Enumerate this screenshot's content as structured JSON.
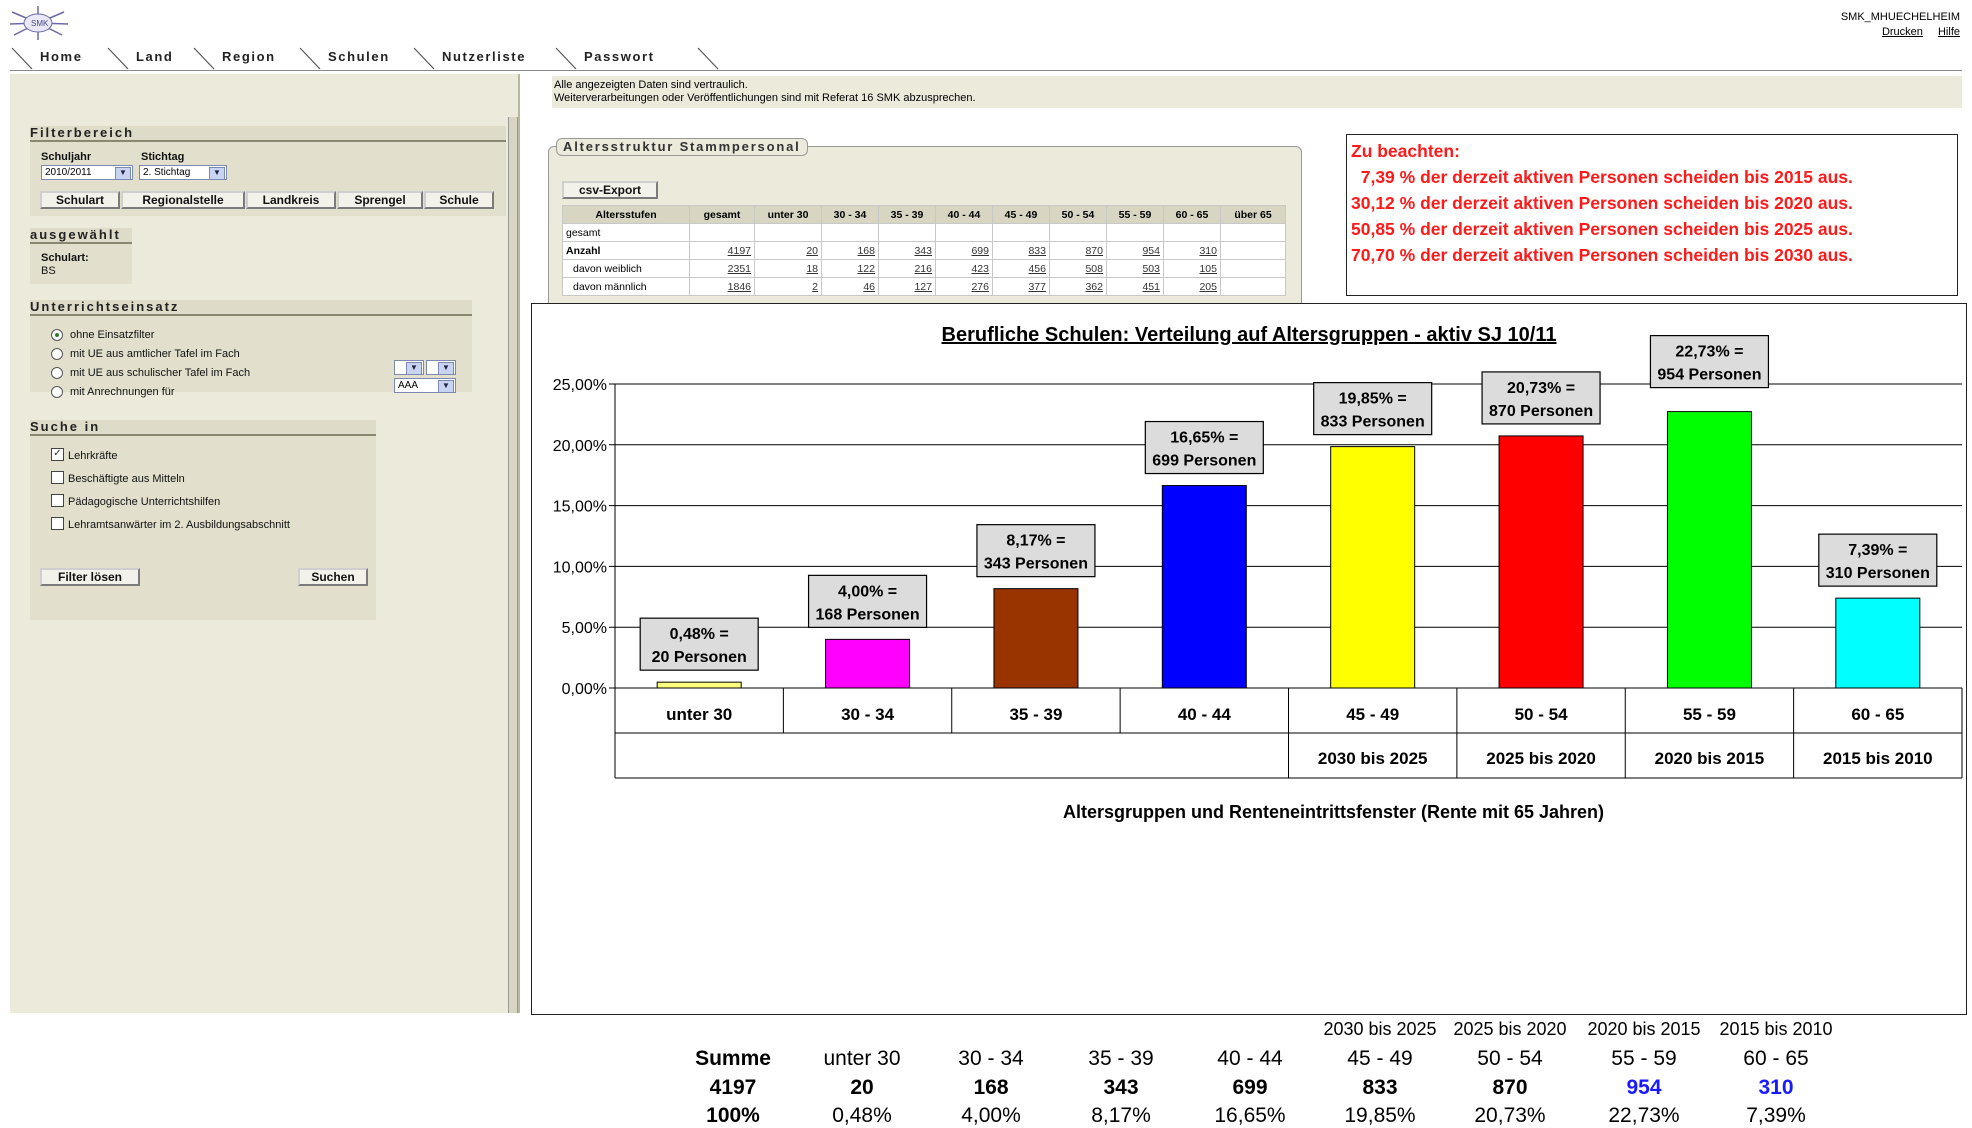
{
  "header": {
    "user": "SMK_MHUECHELHEIM",
    "print_link": "Drucken",
    "help_link": "Hilfe",
    "logo_icon": "sunburst-logo-icon"
  },
  "nav": {
    "tabs": [
      "Home",
      "Land",
      "Region",
      "Schulen",
      "Nutzerliste",
      "Passwort"
    ]
  },
  "notice": {
    "line1": "Alle angezeigten Daten sind vertraulich.",
    "line2": "Weiterverarbeitungen oder Veröffentlichungen sind mit Referat 16 SMK abzusprechen."
  },
  "filter": {
    "title": "Filterbereich",
    "schuljahr_label": "Schuljahr",
    "schuljahr_value": "2010/2011",
    "stichtag_label": "Stichtag",
    "stichtag_value": "2. Stichtag",
    "buttons": [
      "Schulart",
      "Regionalstelle",
      "Landkreis",
      "Sprengel",
      "Schule"
    ]
  },
  "selected": {
    "title": "ausgewählt",
    "label": "Schulart:",
    "value": "BS"
  },
  "unterricht": {
    "title": "Unterrichtseinsatz",
    "options": [
      "ohne Einsatzfilter",
      "mit UE aus amtlicher Tafel im Fach",
      "mit UE aus schulischer Tafel im Fach",
      "mit Anrechnungen für"
    ],
    "selected_index": 0,
    "anrechnung_value": "AAA"
  },
  "suche": {
    "title": "Suche in",
    "options": [
      "Lehrkräfte",
      "Beschäftigte aus Mitteln",
      "Pädagogische Unterrichtshilfen",
      "Lehramtsanwärter im 2. Ausbildungsabschnitt"
    ],
    "checked": [
      true,
      false,
      false,
      false
    ],
    "reset_button": "Filter lösen",
    "search_button": "Suchen"
  },
  "altersstruktur": {
    "legend": "Altersstruktur Stammpersonal",
    "csv_button": "csv-Export",
    "headers": [
      "Altersstufen",
      "gesamt",
      "unter 30",
      "30 - 34",
      "35 - 39",
      "40 - 44",
      "45 - 49",
      "50 - 54",
      "55 - 59",
      "60 - 65",
      "über 65"
    ],
    "rows": [
      {
        "label": "gesamt",
        "values": [
          "",
          "",
          "",
          "",
          "",
          "",
          "",
          "",
          "",
          ""
        ]
      },
      {
        "label": "Anzahl",
        "values": [
          "4197",
          "20",
          "168",
          "343",
          "699",
          "833",
          "870",
          "954",
          "310",
          ""
        ]
      },
      {
        "label": "davon weiblich",
        "values": [
          "2351",
          "18",
          "122",
          "216",
          "423",
          "456",
          "508",
          "503",
          "105",
          ""
        ]
      },
      {
        "label": "davon männlich",
        "values": [
          "1846",
          "2",
          "46",
          "127",
          "276",
          "377",
          "362",
          "451",
          "205",
          ""
        ]
      }
    ]
  },
  "warning": {
    "title": "Zu beachten:",
    "lines": [
      "  7,39 % der derzeit aktiven Personen scheiden bis 2015 aus.",
      "30,12 % der derzeit aktiven Personen scheiden bis 2020 aus.",
      "50,85 % der derzeit aktiven Personen scheiden bis 2025 aus.",
      "70,70 % der derzeit aktiven Personen scheiden bis 2030 aus."
    ]
  },
  "chart_data": {
    "type": "bar",
    "title": "Berufliche Schulen: Verteilung auf Altersgruppen - aktiv SJ 10/11",
    "xlabel": "Altersgruppen und Renteneintrittsfenster (Rente mit 65 Jahren)",
    "ylabel": "",
    "ylim": [
      0,
      25
    ],
    "yticks": [
      "0,00%",
      "5,00%",
      "10,00%",
      "15,00%",
      "20,00%",
      "25,00%"
    ],
    "categories": [
      "unter 30",
      "30 - 34",
      "35 - 39",
      "40 - 44",
      "45 - 49",
      "50 - 54",
      "55 - 59",
      "60 - 65"
    ],
    "windows": [
      "",
      "",
      "",
      "",
      "2030 bis 2025",
      "2025 bis 2020",
      "2020 bis 2015",
      "2015 bis 2010"
    ],
    "values": [
      0.48,
      4.0,
      8.17,
      16.65,
      19.85,
      20.73,
      22.73,
      7.39
    ],
    "counts": [
      20,
      168,
      343,
      699,
      833,
      870,
      954,
      310
    ],
    "labels_line1": [
      "0,48% =",
      "4,00% =",
      "8,17% =",
      "16,65% =",
      "19,85% =",
      "20,73% =",
      "22,73% =",
      "7,39% ="
    ],
    "labels_line2": [
      "20 Personen",
      "168 Personen",
      "343 Personen",
      "699 Personen",
      "833 Personen",
      "870 Personen",
      "954 Personen",
      "310 Personen"
    ],
    "colors": [
      "#ffff80",
      "#ff00ff",
      "#993300",
      "#0000ff",
      "#ffff00",
      "#ff0000",
      "#00ff00",
      "#00ffff"
    ],
    "grid": true,
    "legend": "none"
  },
  "summary": {
    "windows": [
      "2030 bis 2025",
      "2025 bis 2020",
      "2020 bis 2015",
      "2015 bis 2010"
    ],
    "header_label": "Summe",
    "categories": [
      "unter 30",
      "30 - 34",
      "35 - 39",
      "40 - 44",
      "45 - 49",
      "50 - 54",
      "55 - 59",
      "60 - 65"
    ],
    "total": "4197",
    "counts": [
      "20",
      "168",
      "343",
      "699",
      "833",
      "870",
      "954",
      "310"
    ],
    "total_pct": "100%",
    "pcts": [
      "0,48%",
      "4,00%",
      "8,17%",
      "16,65%",
      "19,85%",
      "20,73%",
      "22,73%",
      "7,39%"
    ],
    "highlight_color": "#1a1aff"
  }
}
